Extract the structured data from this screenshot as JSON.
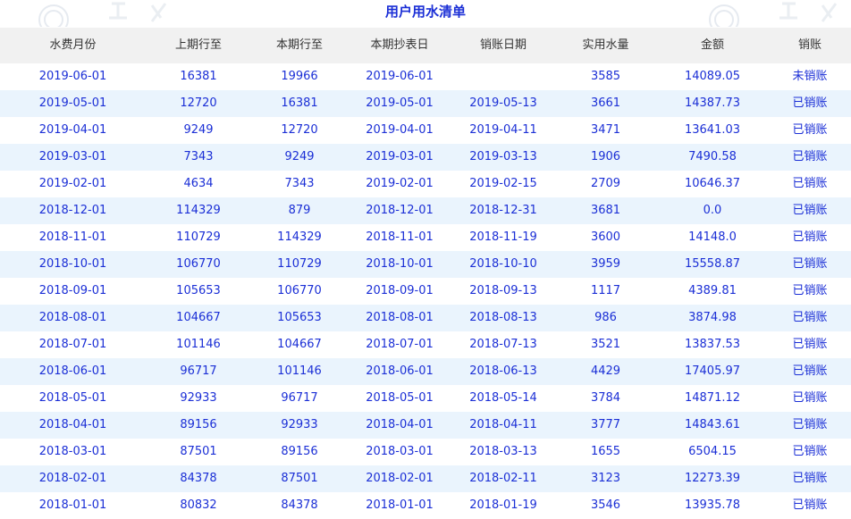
{
  "title": "用户用水清单",
  "columns": [
    "水费月份",
    "上期行至",
    "本期行至",
    "本期抄表日",
    "销账日期",
    "实用水量",
    "金额",
    "销账"
  ],
  "rows": [
    [
      "2019-06-01",
      "16381",
      "19966",
      "2019-06-01",
      "",
      "3585",
      "14089.05",
      "未销账"
    ],
    [
      "2019-05-01",
      "12720",
      "16381",
      "2019-05-01",
      "2019-05-13",
      "3661",
      "14387.73",
      "已销账"
    ],
    [
      "2019-04-01",
      "9249",
      "12720",
      "2019-04-01",
      "2019-04-11",
      "3471",
      "13641.03",
      "已销账"
    ],
    [
      "2019-03-01",
      "7343",
      "9249",
      "2019-03-01",
      "2019-03-13",
      "1906",
      "7490.58",
      "已销账"
    ],
    [
      "2019-02-01",
      "4634",
      "7343",
      "2019-02-01",
      "2019-02-15",
      "2709",
      "10646.37",
      "已销账"
    ],
    [
      "2018-12-01",
      "114329",
      "879",
      "2018-12-01",
      "2018-12-31",
      "3681",
      "0.0",
      "已销账"
    ],
    [
      "2018-11-01",
      "110729",
      "114329",
      "2018-11-01",
      "2018-11-19",
      "3600",
      "14148.0",
      "已销账"
    ],
    [
      "2018-10-01",
      "106770",
      "110729",
      "2018-10-01",
      "2018-10-10",
      "3959",
      "15558.87",
      "已销账"
    ],
    [
      "2018-09-01",
      "105653",
      "106770",
      "2018-09-01",
      "2018-09-13",
      "1117",
      "4389.81",
      "已销账"
    ],
    [
      "2018-08-01",
      "104667",
      "105653",
      "2018-08-01",
      "2018-08-13",
      "986",
      "3874.98",
      "已销账"
    ],
    [
      "2018-07-01",
      "101146",
      "104667",
      "2018-07-01",
      "2018-07-13",
      "3521",
      "13837.53",
      "已销账"
    ],
    [
      "2018-06-01",
      "96717",
      "101146",
      "2018-06-01",
      "2018-06-13",
      "4429",
      "17405.97",
      "已销账"
    ],
    [
      "2018-05-01",
      "92933",
      "96717",
      "2018-05-01",
      "2018-05-14",
      "3784",
      "14871.12",
      "已销账"
    ],
    [
      "2018-04-01",
      "89156",
      "92933",
      "2018-04-01",
      "2018-04-11",
      "3777",
      "14843.61",
      "已销账"
    ],
    [
      "2018-03-01",
      "87501",
      "89156",
      "2018-03-01",
      "2018-03-13",
      "1655",
      "6504.15",
      "已销账"
    ],
    [
      "2018-02-01",
      "84378",
      "87501",
      "2018-02-01",
      "2018-02-11",
      "3123",
      "12273.39",
      "已销账"
    ],
    [
      "2018-01-01",
      "80832",
      "84378",
      "2018-01-01",
      "2018-01-19",
      "3546",
      "13935.78",
      "已销账"
    ]
  ],
  "colors": {
    "text_blue": "#1b2fd6",
    "header_bg": "#f1f1f1",
    "stripe_bg": "#eaf4fd"
  }
}
